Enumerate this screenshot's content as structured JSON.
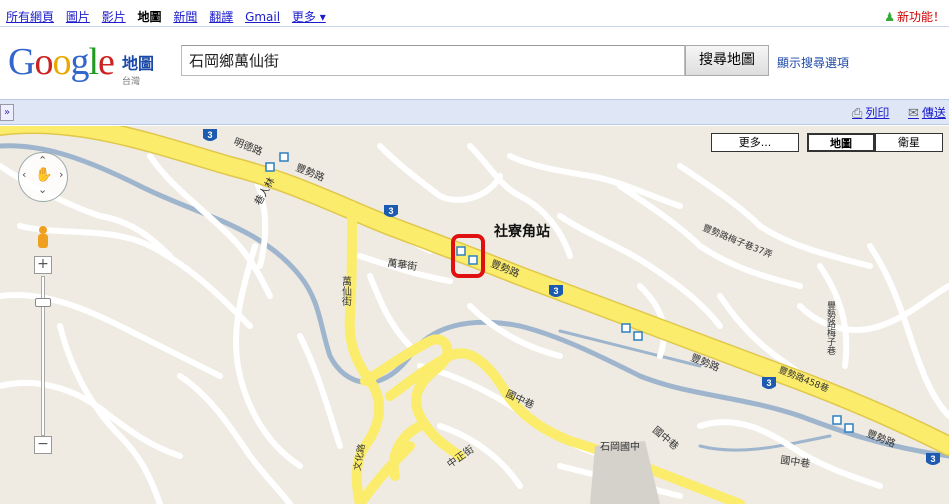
{
  "topnav": {
    "items": [
      "所有網頁",
      "圖片",
      "影片",
      "地圖",
      "新聞",
      "翻譯",
      "Gmail",
      "更多 ▾"
    ],
    "current": "地圖",
    "new_features": "新功能！"
  },
  "header": {
    "logo": {
      "g1": "G",
      "o1": "o",
      "o2": "o",
      "g2": "g",
      "l": "l",
      "e": "e"
    },
    "product": "地圖",
    "region": "台灣",
    "search_value": "石岡鄉萬仙街",
    "search_button": "搜尋地圖",
    "search_options": "顯示搜尋選項"
  },
  "toolbar": {
    "collapse": "»",
    "print_label": "列印",
    "send_label": "傳送"
  },
  "map": {
    "type_buttons": {
      "more": "更多...",
      "map": "地圖",
      "satellite": "衛星"
    },
    "annotation": "社寮角站",
    "labels": {
      "mingde": "明德路",
      "fengshi1": "豐勢路",
      "fengshi2": "豐勢路",
      "fengshi3": "豐勢路",
      "fengshi4": "豐勢路",
      "wanhua": "萬華街",
      "wanxian": "萬仙街",
      "xianglin": "巷人林",
      "meizi37": "豐勢路梅子巷37弄",
      "meizi": "豐勢路梅子巷",
      "lane458": "豐勢路458巷",
      "guozhong1": "國中巷",
      "guozhong2": "國中巷",
      "guozhong3": "國中巷",
      "zhongzheng": "中正街",
      "school": "石岡國中",
      "wenhua": "文化路"
    },
    "route_shield": "3",
    "colors": {
      "road_major": "#fbec6c",
      "road_minor": "#ffffff",
      "river": "#9eb5cd",
      "land": "#efebe2",
      "highlight": "#e01010"
    }
  }
}
